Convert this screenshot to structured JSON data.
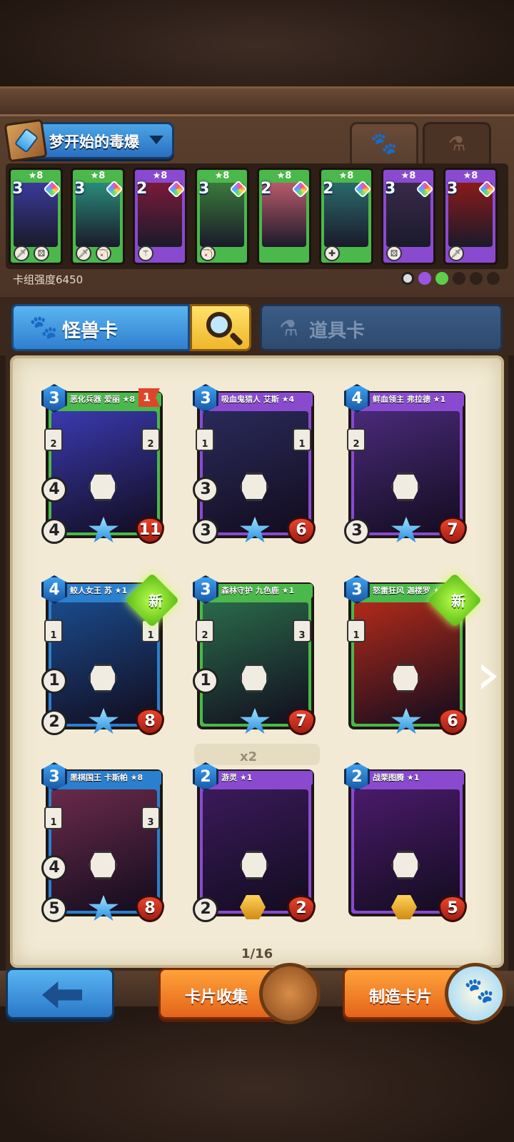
{
  "deck": {
    "name": "梦开始的毒爆",
    "power_label": "卡组强度6450",
    "mini_cards": [
      {
        "cost": "3",
        "stars": "★8",
        "color": "#4ab84a",
        "art": "#3a3a9a",
        "icons": [
          "🗡",
          "⚄"
        ]
      },
      {
        "cost": "3",
        "stars": "★8",
        "color": "#4ab84a",
        "art": "#2a8a7a",
        "icons": [
          "🗡",
          "🏹"
        ]
      },
      {
        "cost": "2",
        "stars": "★8",
        "color": "#8a4ad0",
        "art": "#7a1a3a",
        "icons": [
          "⚚"
        ]
      },
      {
        "cost": "3",
        "stars": "★8",
        "color": "#4ab84a",
        "art": "#3a7a3a",
        "icons": [
          "🏹"
        ]
      },
      {
        "cost": "2",
        "stars": "★8",
        "color": "#4ab84a",
        "art": "#b85a6a",
        "icons": []
      },
      {
        "cost": "2",
        "stars": "★8",
        "color": "#4ab84a",
        "art": "#2a6a6a",
        "icons": [
          "✚"
        ]
      },
      {
        "cost": "3",
        "stars": "★8",
        "color": "#8a4ad0",
        "art": "#3a2a4a",
        "icons": [
          "⚄"
        ]
      },
      {
        "cost": "3",
        "stars": "★8",
        "color": "#8a4ad0",
        "art": "#8a1a1a",
        "icons": [
          "🗡"
        ]
      }
    ]
  },
  "tabs": {
    "monster": "怪兽卡",
    "item": "道具卡",
    "monster_icon": "paw-icon",
    "item_icon": "flask-icon"
  },
  "cards": [
    {
      "name": "恶化兵器 爱丽 ★8",
      "cost": "3",
      "atk": "4",
      "def": "4",
      "hp": "11",
      "frame": "#4ab84a",
      "art": "#3a3ab0",
      "gem": "star",
      "flag": "1",
      "new": false,
      "side_left": "2",
      "side_right": "2"
    },
    {
      "name": "吸血鬼猎人 艾斯 ★4",
      "cost": "3",
      "atk": "3",
      "def": "3",
      "hp": "6",
      "frame": "#8a4ad0",
      "art": "#2a2a5a",
      "gem": "star",
      "flag": "",
      "new": false,
      "side_left": "1",
      "side_right": "1"
    },
    {
      "name": "鲜血领主 弗拉德 ★1",
      "cost": "4",
      "atk": "",
      "def": "3",
      "hp": "7",
      "frame": "#8a4ad0",
      "art": "#4a2a7a",
      "gem": "star",
      "flag": "",
      "new": false,
      "side_left": "2",
      "side_right": ""
    },
    {
      "name": "鲛人女王 苏 ★1",
      "cost": "4",
      "atk": "1",
      "def": "2",
      "hp": "8",
      "frame": "#2a7fcf",
      "art": "#1a4a8a",
      "gem": "star",
      "flag": "",
      "new": true,
      "side_left": "1",
      "side_right": "1"
    },
    {
      "name": "森林守护 九色鹿 ★1",
      "cost": "3",
      "atk": "1",
      "def": "",
      "hp": "7",
      "frame": "#4ab84a",
      "art": "#2a6a4a",
      "gem": "star",
      "flag": "",
      "new": false,
      "side_left": "2",
      "side_right": "3"
    },
    {
      "name": "怒雷狂风 迦楼罗 ★1",
      "cost": "3",
      "atk": "",
      "def": "",
      "hp": "6",
      "frame": "#4ab84a",
      "art": "#b02a1a",
      "gem": "star",
      "flag": "",
      "new": true,
      "side_left": "1",
      "side_right": ""
    },
    {
      "name": "黑棋国王 卡斯帕 ★8",
      "cost": "3",
      "atk": "4",
      "def": "5",
      "hp": "8",
      "frame": "#2a7fcf",
      "art": "#6a2a4a",
      "gem": "star",
      "flag": "",
      "new": false,
      "side_left": "1",
      "side_right": "3"
    },
    {
      "name": "游灵 ★1",
      "cost": "2",
      "atk": "",
      "def": "2",
      "hp": "2",
      "frame": "#8a4ad0",
      "art": "#3a1a5a",
      "gem": "hex",
      "flag": "",
      "new": false,
      "side_left": "",
      "side_right": ""
    },
    {
      "name": "战栗图腾 ★1",
      "cost": "2",
      "atk": "",
      "def": "",
      "hp": "5",
      "frame": "#8a4ad0",
      "art": "#4a1a6a",
      "gem": "hex",
      "flag": "",
      "new": false,
      "side_left": "",
      "side_right": ""
    }
  ],
  "new_label": "新",
  "dup_count": "x2",
  "page": "1/16",
  "buttons": {
    "collect": "卡片收集",
    "craft": "制造卡片"
  }
}
